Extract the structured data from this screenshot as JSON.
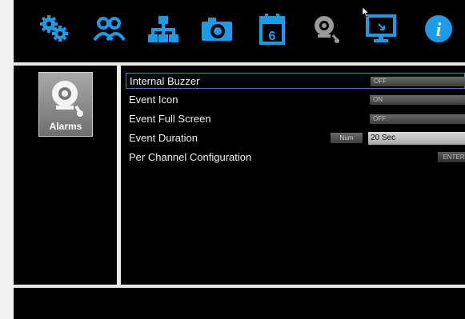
{
  "toolbar": {
    "icons": [
      {
        "name": "system-settings-icon"
      },
      {
        "name": "users-icon"
      },
      {
        "name": "network-icon"
      },
      {
        "name": "camera-icon"
      },
      {
        "name": "schedule-icon",
        "text": "6"
      },
      {
        "name": "alarm-bell-icon"
      },
      {
        "name": "display-icon"
      },
      {
        "name": "info-icon",
        "text": "i"
      }
    ]
  },
  "sidebar": {
    "items": [
      {
        "label": "Alarms",
        "icon": "alarm-bell-icon"
      }
    ]
  },
  "menu": {
    "rows": [
      {
        "label": "Internal Buzzer",
        "value": "OFF"
      },
      {
        "label": "Event Icon",
        "value": "ON"
      },
      {
        "label": "Event Full Screen",
        "value": "OFF"
      },
      {
        "label": "Event Duration",
        "button": "Num",
        "value": "20 Sec"
      },
      {
        "label": "Per Channel Configuration",
        "button": "ENTER"
      }
    ]
  },
  "colors": {
    "accent_blue": "#1e9be6",
    "divider": "#eaeaea",
    "selection_border": "#4a7fd0"
  }
}
